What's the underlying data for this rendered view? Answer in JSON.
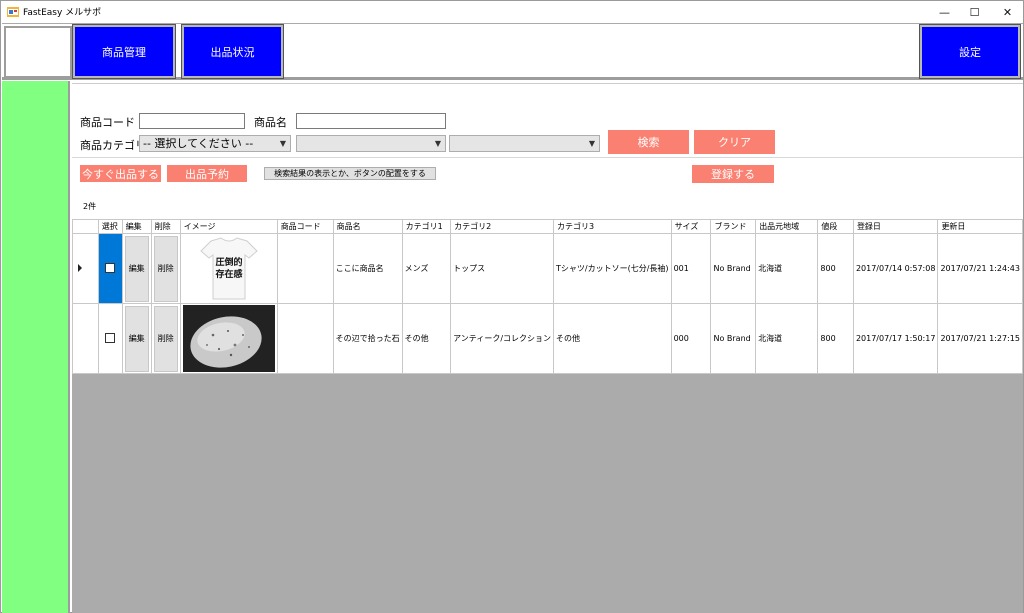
{
  "window": {
    "title": "FastEasy メルサポ",
    "minimize": "—",
    "maximize": "☐",
    "close": "✕"
  },
  "nav": {
    "goods": "商品管理",
    "status": "出品状況",
    "settings": "設定"
  },
  "filters": {
    "code_label": "商品コード",
    "code_value": "",
    "name_label": "商品名",
    "name_value": "",
    "category_label": "商品カテゴリ",
    "category1_selected": "-- 選択してください --",
    "category2_selected": "",
    "category3_selected": "",
    "search_button": "検索",
    "clear_button": "クリア"
  },
  "actions": {
    "list_now": "今すぐ出品する",
    "reserve": "出品予約",
    "placeholder_note": "検索結果の表示とか、ボタンの配置をする",
    "register": "登録する"
  },
  "result_count": "2件",
  "grid": {
    "columns": [
      "選択",
      "編集",
      "削除",
      "イメージ",
      "商品コード",
      "商品名",
      "カテゴリ1",
      "カテゴリ2",
      "カテゴリ3",
      "サイズ",
      "ブランド",
      "出品元地域",
      "値段",
      "登録日",
      "更新日"
    ],
    "rows": [
      {
        "selected": false,
        "edit": "編集",
        "delete": "削除",
        "image": "tshirt-image",
        "image_text1": "圧倒的",
        "image_text2": "存在感",
        "code": "",
        "name": "ここに商品名",
        "cat1": "メンズ",
        "cat2": "トップス",
        "cat3": "Tシャツ/カットソー(七分/長袖)",
        "size": "001",
        "brand": "No Brand",
        "region": "北海道",
        "price": "800",
        "registered": "2017/07/14 0:57:08",
        "updated": "2017/07/21 1:24:43"
      },
      {
        "selected": false,
        "edit": "編集",
        "delete": "削除",
        "image": "stone-image",
        "code": "",
        "name": "その辺で拾った石",
        "cat1": "その他",
        "cat2": "アンティーク/コレクション",
        "cat3": "その他",
        "size": "000",
        "brand": "No Brand",
        "region": "北海道",
        "price": "800",
        "registered": "2017/07/17 1:50:17",
        "updated": "2017/07/21 1:27:15"
      }
    ]
  },
  "colors": {
    "nav_blue": "#0000ff",
    "sidebar_green": "#80ff80",
    "action_salmon": "#fa8072",
    "grid_bg": "#ababab",
    "selection_blue": "#0078d7"
  }
}
